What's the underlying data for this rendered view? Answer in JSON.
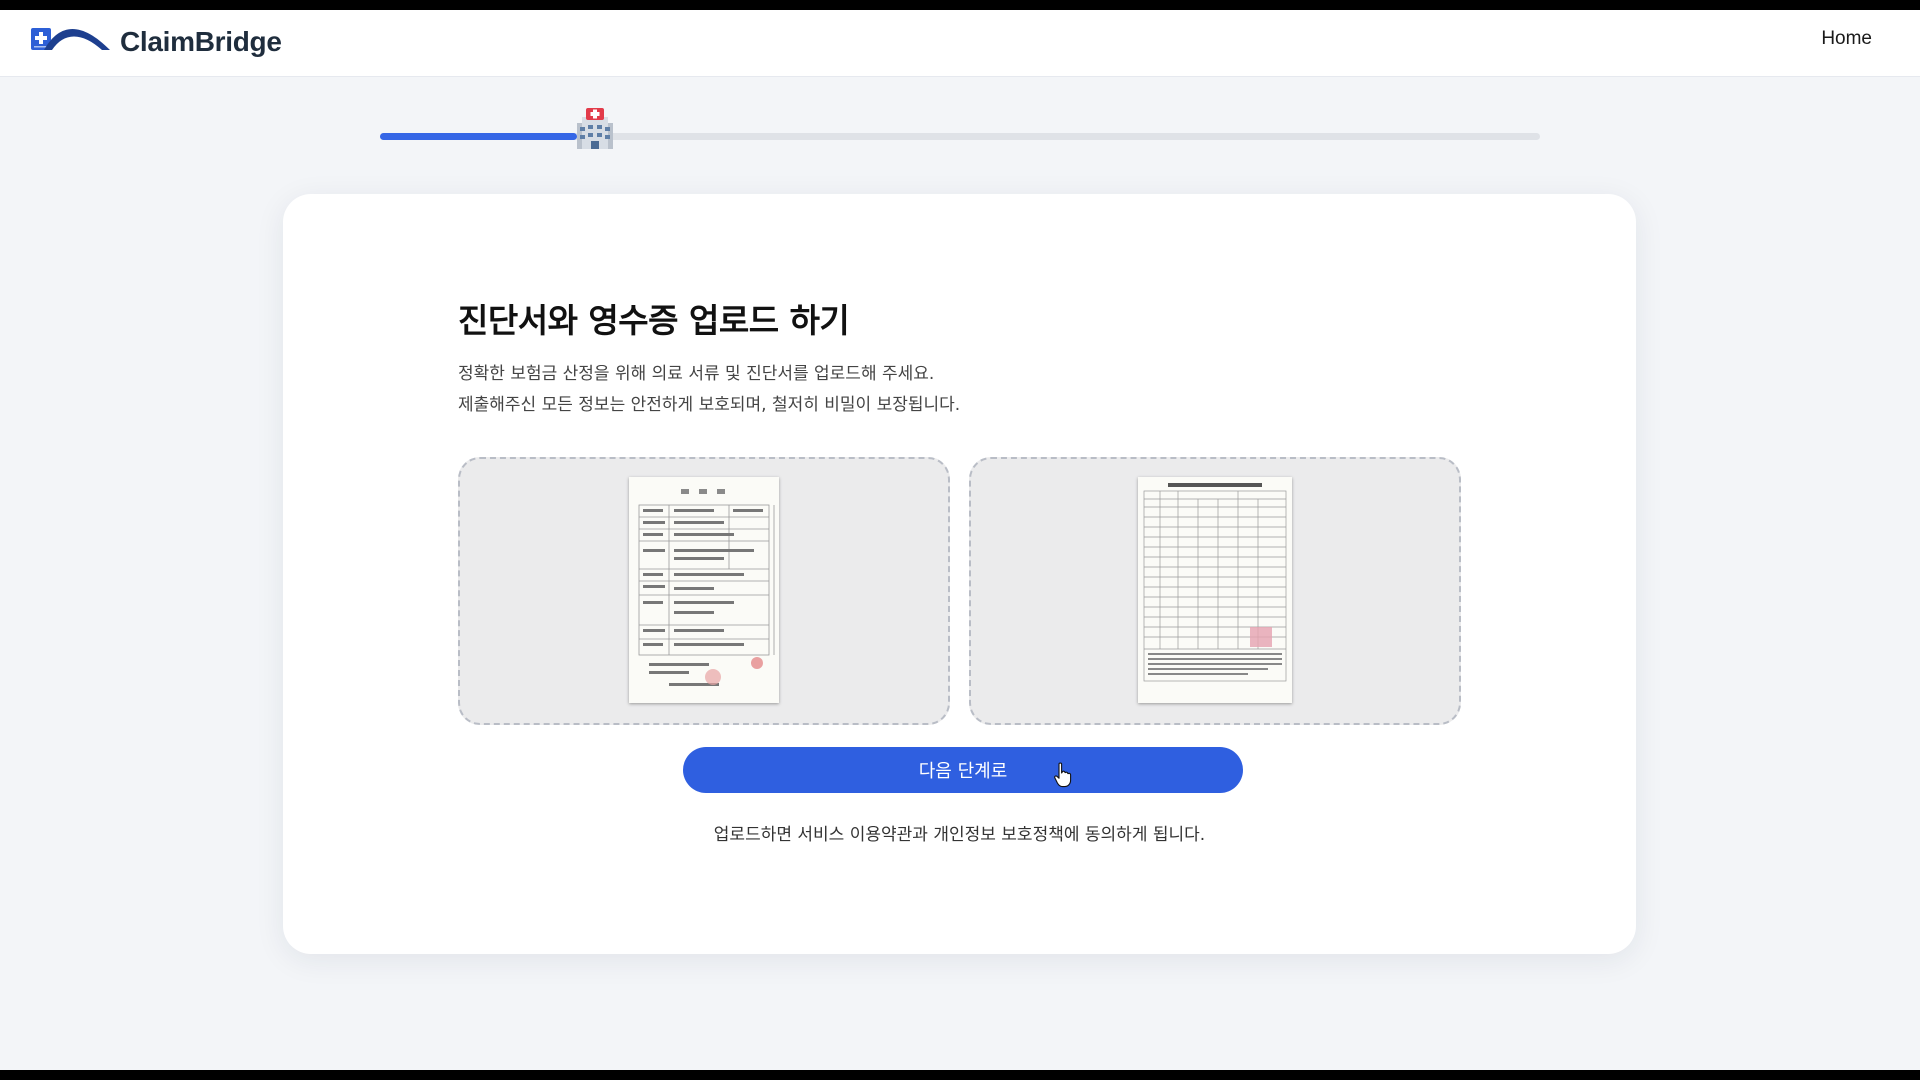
{
  "header": {
    "brand": "ClaimBridge",
    "nav_home": "Home"
  },
  "progress": {
    "fraction": 0.17,
    "marker_icon": "hospital-icon"
  },
  "upload_page": {
    "title": "진단서와 영수증 업로드 하기",
    "description_line1": "정확한 보험금 산정을 위해 의료 서류 및 진단서를 업로드해 주세요.",
    "description_line2": "제출해주신 모든 정보는 안전하게 보호되며, 철저히 비밀이 보장됩니다.",
    "next_button": "다음 단계로",
    "consent_text": "업로드하면 서비스 이용약관과 개인정보 보호정책에 동의하게 됩니다."
  },
  "colors": {
    "accent": "#2f5fe0",
    "progress_track": "#dfe2e7",
    "background": "#f3f5f8"
  }
}
